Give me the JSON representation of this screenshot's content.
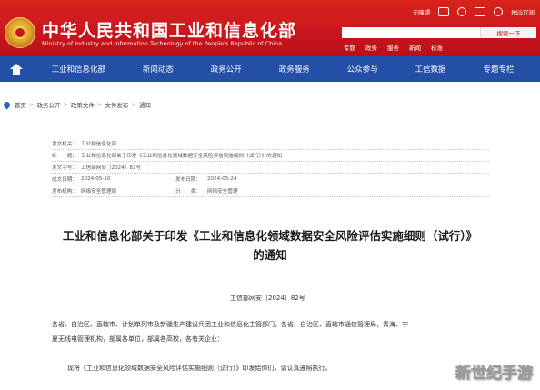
{
  "header": {
    "title": "中华人民共和国工业和信息化部",
    "subtitle": "Ministry of Industry and Information Technology of the People's Republic of China",
    "top_links": [
      "无障碍",
      "",
      "",
      "",
      "",
      "RSS订阅"
    ],
    "search": {
      "placeholder": "",
      "button": "搜索一下"
    },
    "quick_links": [
      "专题",
      "政务",
      "服务",
      "新闻",
      "标准"
    ]
  },
  "nav": {
    "items": [
      "工业和信息化部",
      "新闻动态",
      "政务公开",
      "政务服务",
      "公众参与",
      "工信数据",
      "专题专栏"
    ]
  },
  "breadcrumb": {
    "items": [
      "首页",
      "政务公开",
      "政策文件",
      "文件发布",
      "通知"
    ]
  },
  "info": {
    "rows": [
      {
        "k": "发文机关：",
        "v": "工业和信息化部"
      },
      {
        "k": "标　　题：",
        "v": "工业和信息化部关于印发《工业和信息化领域数据安全风险评估实施细则（试行）》的通知"
      },
      {
        "k": "发文字号：",
        "v": "工信部网安〔2024〕82号"
      },
      {
        "k": "成文日期：",
        "v": "2024-05-10",
        "k2": "发布日期：",
        "v2": "2024-05-24"
      },
      {
        "k": "发布机构：",
        "v": "网络安全管理局",
        "k2": "分　　类：",
        "v2": "网络安全管理"
      }
    ]
  },
  "document": {
    "title_line1": "工业和信息化部关于印发《工业和信息化领域数据安全风险评估实施细则（试行）》",
    "title_line2": "的通知",
    "number": "工信部网安〔2024〕82号",
    "para1": "各省、自治区、直辖市、计划单列市及新疆生产建设兵团工业和信息化主管部门，各省、自治区、直辖市通信管理局，青海、宁",
    "para2": "夏无线电管理机构，部属各单位，部属各高校，各有关企业：",
    "para3": "现将《工业和信息化领域数据安全风险评估实施细则（试行）》印发给你们，请认真遵照执行。"
  },
  "watermark": "新世纪手游",
  "colors": {
    "header_red": "#c8161d",
    "nav_blue": "#234fa6"
  }
}
